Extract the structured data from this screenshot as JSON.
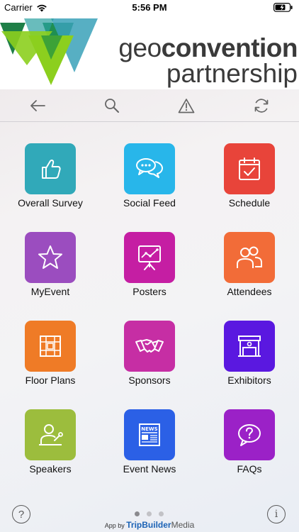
{
  "status": {
    "carrier": "Carrier",
    "time": "5:56 PM"
  },
  "brand": {
    "line1_a": "geo",
    "line1_b": "convention",
    "line2": "partnership",
    "colors": {
      "teal": "#3aa1b8",
      "green": "#8ccf1e",
      "dark_green": "#1f7f47"
    }
  },
  "toolbar": {
    "back": "arrow-left-icon",
    "search": "search-icon",
    "alert": "warning-icon",
    "refresh": "refresh-icon"
  },
  "tiles": [
    {
      "label": "Overall Survey",
      "color": "#31a9b9",
      "icon": "thumbs-up-icon"
    },
    {
      "label": "Social Feed",
      "color": "#28b6ea",
      "icon": "chat-bubbles-icon"
    },
    {
      "label": "Schedule",
      "color": "#e8443a",
      "icon": "calendar-check-icon"
    },
    {
      "label": "MyEvent",
      "color": "#9b4dbf",
      "icon": "star-icon"
    },
    {
      "label": "Posters",
      "color": "#c51ea3",
      "icon": "presentation-icon"
    },
    {
      "label": "Attendees",
      "color": "#f26c38",
      "icon": "people-icon"
    },
    {
      "label": "Floor Plans",
      "color": "#ef7b26",
      "icon": "floor-plan-icon"
    },
    {
      "label": "Sponsors",
      "color": "#c62ea4",
      "icon": "handshake-icon"
    },
    {
      "label": "Exhibitors",
      "color": "#5a18e0",
      "icon": "booth-icon"
    },
    {
      "label": "Speakers",
      "color": "#9cbd3d",
      "icon": "speaker-icon"
    },
    {
      "label": "Event News",
      "color": "#2b60e6",
      "icon": "newspaper-icon"
    },
    {
      "label": "FAQs",
      "color": "#9b21c7",
      "icon": "question-bubble-icon"
    }
  ],
  "footer": {
    "help": "?",
    "info": "i",
    "credit_prefix": "App by",
    "credit_brand_a": "TripBuilder",
    "credit_brand_b": "Media",
    "page_count": 3,
    "active_page": 1
  }
}
